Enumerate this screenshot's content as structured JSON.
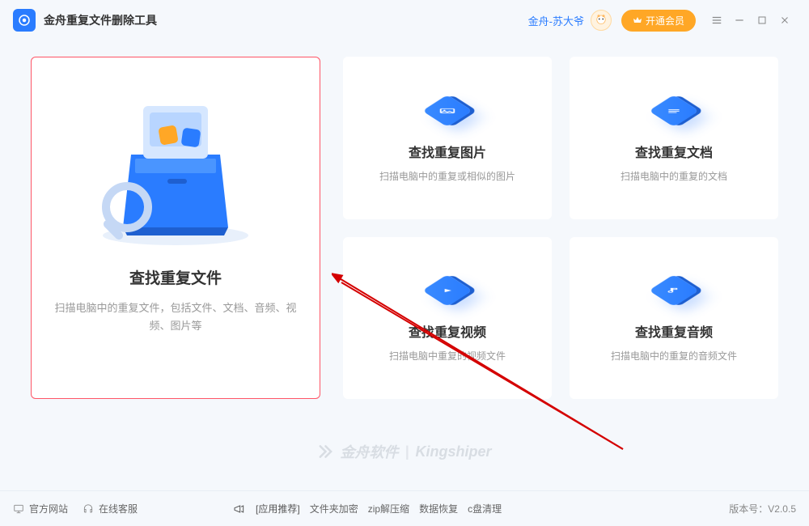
{
  "header": {
    "app_title": "金舟重复文件删除工具",
    "user_name": "金舟-苏大爷",
    "vip_label": "开通会员"
  },
  "main_card": {
    "title": "查找重复文件",
    "desc": "扫描电脑中的重复文件，包括文件、文档、音频、视频、图片等"
  },
  "cards": [
    {
      "title": "查找重复图片",
      "desc": "扫描电脑中的重复或相似的图片"
    },
    {
      "title": "查找重复文档",
      "desc": "扫描电脑中的重复的文档"
    },
    {
      "title": "查找重复视频",
      "desc": "扫描电脑中重复的视频文件"
    },
    {
      "title": "查找重复音频",
      "desc": "扫描电脑中的重复的音频文件"
    }
  ],
  "watermark": {
    "brand": "金舟软件",
    "en": "Kingshiper"
  },
  "footer": {
    "official": "官方网站",
    "support": "在线客服",
    "rec_label": "[应用推荐]",
    "recs": [
      "文件夹加密",
      "zip解压缩",
      "数据恢复",
      "c盘清理"
    ],
    "version_label": "版本号：",
    "version": "V2.0.5"
  }
}
